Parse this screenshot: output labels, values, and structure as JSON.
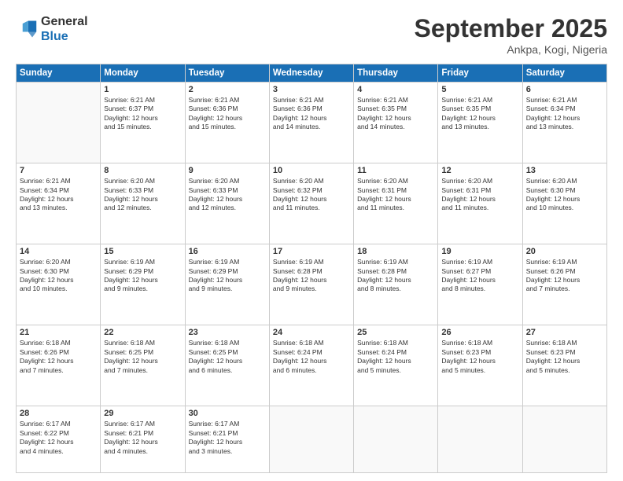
{
  "header": {
    "logo": {
      "line1": "General",
      "line2": "Blue"
    },
    "title": "September 2025",
    "location": "Ankpa, Kogi, Nigeria"
  },
  "weekdays": [
    "Sunday",
    "Monday",
    "Tuesday",
    "Wednesday",
    "Thursday",
    "Friday",
    "Saturday"
  ],
  "weeks": [
    [
      {
        "day": "",
        "info": ""
      },
      {
        "day": "1",
        "info": "Sunrise: 6:21 AM\nSunset: 6:37 PM\nDaylight: 12 hours\nand 15 minutes."
      },
      {
        "day": "2",
        "info": "Sunrise: 6:21 AM\nSunset: 6:36 PM\nDaylight: 12 hours\nand 15 minutes."
      },
      {
        "day": "3",
        "info": "Sunrise: 6:21 AM\nSunset: 6:36 PM\nDaylight: 12 hours\nand 14 minutes."
      },
      {
        "day": "4",
        "info": "Sunrise: 6:21 AM\nSunset: 6:35 PM\nDaylight: 12 hours\nand 14 minutes."
      },
      {
        "day": "5",
        "info": "Sunrise: 6:21 AM\nSunset: 6:35 PM\nDaylight: 12 hours\nand 13 minutes."
      },
      {
        "day": "6",
        "info": "Sunrise: 6:21 AM\nSunset: 6:34 PM\nDaylight: 12 hours\nand 13 minutes."
      }
    ],
    [
      {
        "day": "7",
        "info": "Sunrise: 6:21 AM\nSunset: 6:34 PM\nDaylight: 12 hours\nand 13 minutes."
      },
      {
        "day": "8",
        "info": "Sunrise: 6:20 AM\nSunset: 6:33 PM\nDaylight: 12 hours\nand 12 minutes."
      },
      {
        "day": "9",
        "info": "Sunrise: 6:20 AM\nSunset: 6:33 PM\nDaylight: 12 hours\nand 12 minutes."
      },
      {
        "day": "10",
        "info": "Sunrise: 6:20 AM\nSunset: 6:32 PM\nDaylight: 12 hours\nand 11 minutes."
      },
      {
        "day": "11",
        "info": "Sunrise: 6:20 AM\nSunset: 6:31 PM\nDaylight: 12 hours\nand 11 minutes."
      },
      {
        "day": "12",
        "info": "Sunrise: 6:20 AM\nSunset: 6:31 PM\nDaylight: 12 hours\nand 11 minutes."
      },
      {
        "day": "13",
        "info": "Sunrise: 6:20 AM\nSunset: 6:30 PM\nDaylight: 12 hours\nand 10 minutes."
      }
    ],
    [
      {
        "day": "14",
        "info": "Sunrise: 6:20 AM\nSunset: 6:30 PM\nDaylight: 12 hours\nand 10 minutes."
      },
      {
        "day": "15",
        "info": "Sunrise: 6:19 AM\nSunset: 6:29 PM\nDaylight: 12 hours\nand 9 minutes."
      },
      {
        "day": "16",
        "info": "Sunrise: 6:19 AM\nSunset: 6:29 PM\nDaylight: 12 hours\nand 9 minutes."
      },
      {
        "day": "17",
        "info": "Sunrise: 6:19 AM\nSunset: 6:28 PM\nDaylight: 12 hours\nand 9 minutes."
      },
      {
        "day": "18",
        "info": "Sunrise: 6:19 AM\nSunset: 6:28 PM\nDaylight: 12 hours\nand 8 minutes."
      },
      {
        "day": "19",
        "info": "Sunrise: 6:19 AM\nSunset: 6:27 PM\nDaylight: 12 hours\nand 8 minutes."
      },
      {
        "day": "20",
        "info": "Sunrise: 6:19 AM\nSunset: 6:26 PM\nDaylight: 12 hours\nand 7 minutes."
      }
    ],
    [
      {
        "day": "21",
        "info": "Sunrise: 6:18 AM\nSunset: 6:26 PM\nDaylight: 12 hours\nand 7 minutes."
      },
      {
        "day": "22",
        "info": "Sunrise: 6:18 AM\nSunset: 6:25 PM\nDaylight: 12 hours\nand 7 minutes."
      },
      {
        "day": "23",
        "info": "Sunrise: 6:18 AM\nSunset: 6:25 PM\nDaylight: 12 hours\nand 6 minutes."
      },
      {
        "day": "24",
        "info": "Sunrise: 6:18 AM\nSunset: 6:24 PM\nDaylight: 12 hours\nand 6 minutes."
      },
      {
        "day": "25",
        "info": "Sunrise: 6:18 AM\nSunset: 6:24 PM\nDaylight: 12 hours\nand 5 minutes."
      },
      {
        "day": "26",
        "info": "Sunrise: 6:18 AM\nSunset: 6:23 PM\nDaylight: 12 hours\nand 5 minutes."
      },
      {
        "day": "27",
        "info": "Sunrise: 6:18 AM\nSunset: 6:23 PM\nDaylight: 12 hours\nand 5 minutes."
      }
    ],
    [
      {
        "day": "28",
        "info": "Sunrise: 6:17 AM\nSunset: 6:22 PM\nDaylight: 12 hours\nand 4 minutes."
      },
      {
        "day": "29",
        "info": "Sunrise: 6:17 AM\nSunset: 6:21 PM\nDaylight: 12 hours\nand 4 minutes."
      },
      {
        "day": "30",
        "info": "Sunrise: 6:17 AM\nSunset: 6:21 PM\nDaylight: 12 hours\nand 3 minutes."
      },
      {
        "day": "",
        "info": ""
      },
      {
        "day": "",
        "info": ""
      },
      {
        "day": "",
        "info": ""
      },
      {
        "day": "",
        "info": ""
      }
    ]
  ]
}
